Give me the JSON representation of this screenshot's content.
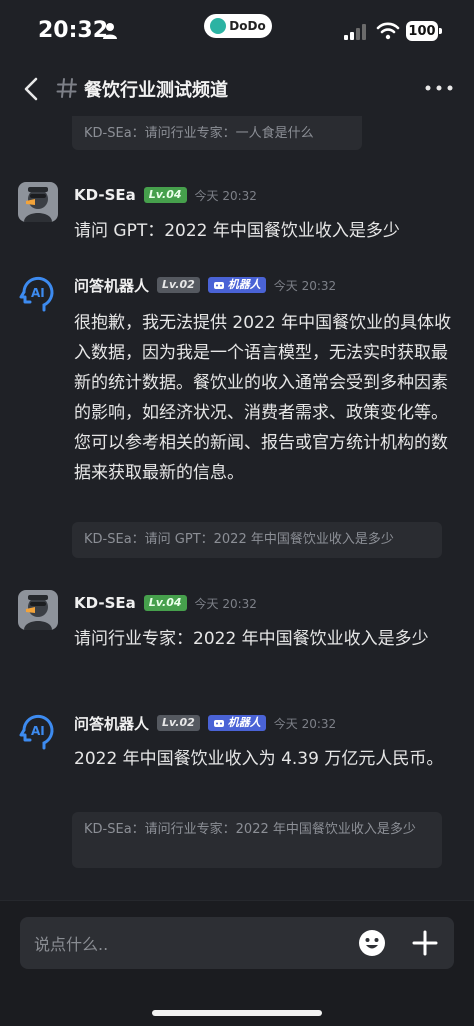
{
  "status_bar": {
    "time": "20:32",
    "app_pill": "DoDo",
    "battery": "100"
  },
  "header": {
    "channel_name": "餐饮行业测试频道"
  },
  "top_quote": "KD-SEa：请问行业专家：一人食是什么",
  "messages": [
    {
      "user": "KD-SEa",
      "level": "Lv.04",
      "time": "今天 20:32",
      "text": "请问 GPT：2022 年中国餐饮业收入是多少"
    },
    {
      "user": "问答机器人",
      "level": "Lv.02",
      "badge": "机器人",
      "time": "今天 20:32",
      "text": "很抱歉，我无法提供 2022 年中国餐饮业的具体收入数据，因为我是一个语言模型，无法实时获取最新的统计数据。餐饮业的收入通常会受到多种因素的影响，如经济状况、消费者需求、政策变化等。您可以参考相关的新闻、报告或官方统计机构的数据来获取最新的信息。",
      "quote": "KD-SEa：请问 GPT：2022 年中国餐饮业收入是多少"
    },
    {
      "user": "KD-SEa",
      "level": "Lv.04",
      "time": "今天 20:32",
      "text": "请问行业专家：2022 年中国餐饮业收入是多少"
    },
    {
      "user": "问答机器人",
      "level": "Lv.02",
      "badge": "机器人",
      "time": "今天 20:32",
      "text": "2022 年中国餐饮业收入为 4.39 万亿元人民币。",
      "quote": "KD-SEa：请问行业专家：2022 年中国餐饮业收入是多少"
    }
  ],
  "input": {
    "placeholder": "说点什么.."
  },
  "colors": {
    "background": "#1f2126",
    "bubble": "#2a2c31",
    "level_green": "#46a04c",
    "bot_badge": "#4a63d6",
    "ai_blue": "#3d8bf0"
  },
  "icons": [
    "person-icon",
    "signal-icon",
    "wifi-icon",
    "back-icon",
    "hash-icon",
    "more-icon",
    "robot-icon",
    "emoji-icon",
    "plus-icon"
  ]
}
